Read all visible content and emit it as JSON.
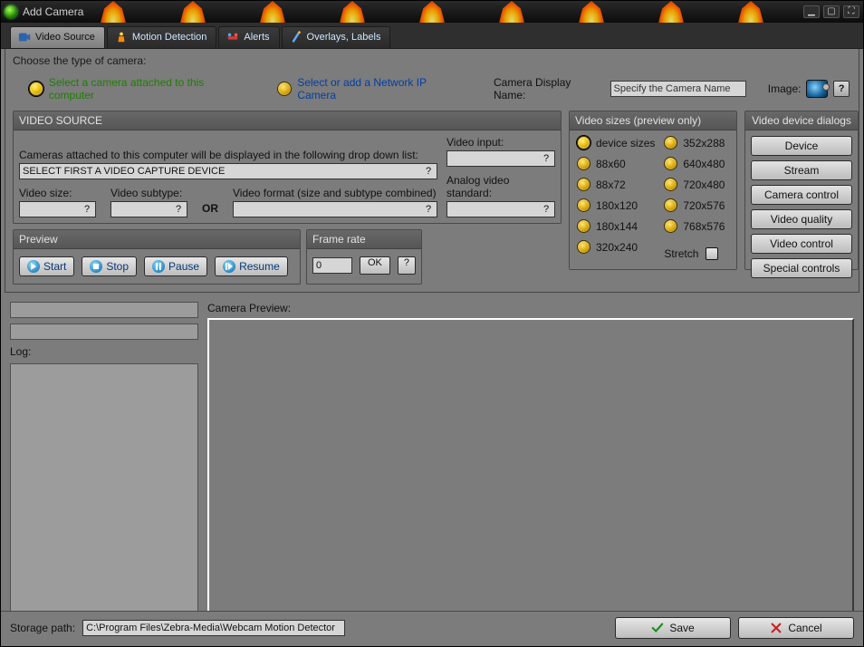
{
  "window": {
    "title": "Add Camera"
  },
  "tabs": [
    {
      "label": "Video Source"
    },
    {
      "label": "Motion Detection"
    },
    {
      "label": "Alerts"
    },
    {
      "label": "Overlays, Labels"
    }
  ],
  "prompt": "Choose the type of camera:",
  "camera_type": {
    "local": "Select a camera attached to this computer",
    "network": "Select or add a Network IP Camera"
  },
  "camera_name": {
    "label": "Camera Display Name:",
    "value": "Specify the Camera Name",
    "image_label": "Image:"
  },
  "video_source": {
    "header": "VIDEO SOURCE",
    "desc": "Cameras attached to this computer will be displayed in the following drop down list:",
    "device_value": "SELECT FIRST A VIDEO CAPTURE DEVICE",
    "video_input_label": "Video input:",
    "video_size_label": "Video size:",
    "video_subtype_label": "Video subtype:",
    "or": "OR",
    "video_format_label": "Video format (size and subtype combined)",
    "analog_label": "Analog video standard:"
  },
  "preview": {
    "header": "Preview",
    "start": "Start",
    "stop": "Stop",
    "pause": "Pause",
    "resume": "Resume"
  },
  "framerate": {
    "header": "Frame rate",
    "value": "0",
    "ok": "OK",
    "help": "?"
  },
  "video_sizes": {
    "header": "Video sizes (preview only)",
    "col1": [
      "device sizes",
      "88x60",
      "88x72",
      "180x120",
      "180x144",
      "320x240"
    ],
    "col2": [
      "352x288",
      "640x480",
      "720x480",
      "720x576",
      "768x576"
    ],
    "stretch": "Stretch"
  },
  "device_dialogs": {
    "header": "Video device dialogs",
    "buttons": [
      "Device",
      "Stream",
      "Camera control",
      "Video quality",
      "Video control",
      "Special controls"
    ]
  },
  "lower": {
    "log_label": "Log:",
    "preview_label": "Camera Preview:"
  },
  "footer": {
    "storage_label": "Storage path:",
    "storage_value": "C:\\Program Files\\Zebra-Media\\Webcam Motion Detector",
    "save": "Save",
    "cancel": "Cancel"
  }
}
